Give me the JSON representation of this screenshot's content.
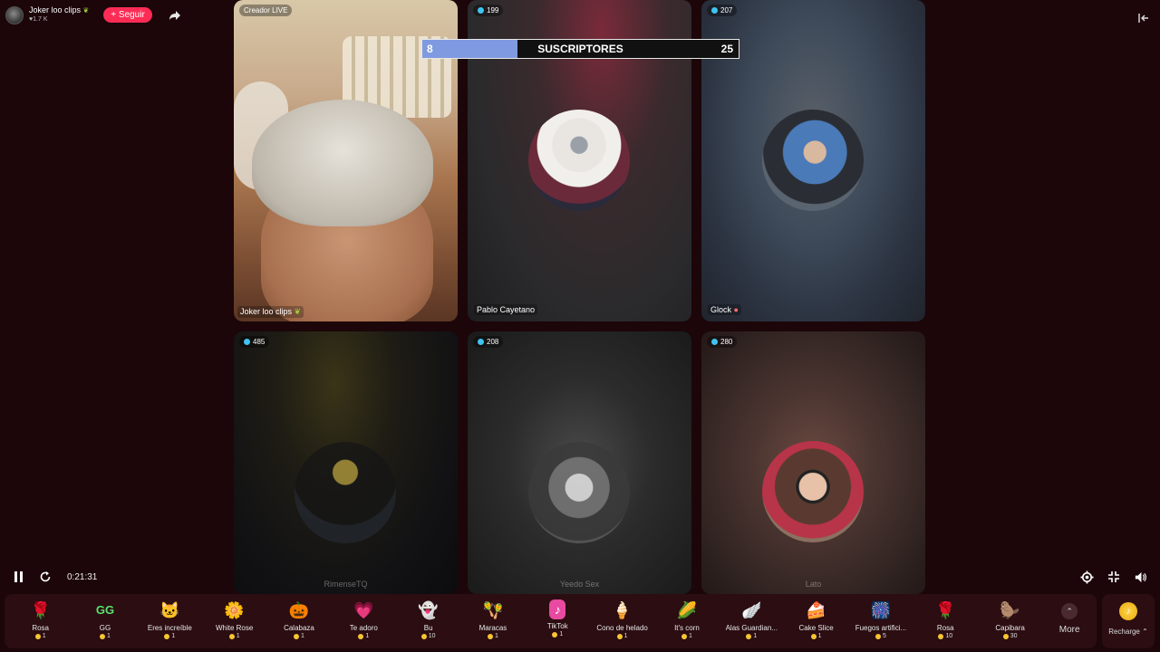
{
  "host": {
    "name": "Joker loo clips",
    "likes": "1.7 K",
    "follow_label": "+ Seguir"
  },
  "subscribers_bar": {
    "title": "SUSCRIPTORES",
    "left_value": "8",
    "right_value": "25",
    "fill_fraction": 0.3,
    "accent_color": "#7f9ae0"
  },
  "tiles": [
    {
      "badge": "Creador LIVE",
      "name": "Joker loo clips",
      "bottom": ""
    },
    {
      "badge": "199",
      "name": "Pablo Cayetano",
      "bottom": ""
    },
    {
      "badge": "207",
      "name": "Glock",
      "bottom": ""
    },
    {
      "badge": "485",
      "name": "",
      "bottom": "RimenseTQ"
    },
    {
      "badge": "208",
      "name": "",
      "bottom": "Yeedo Sex"
    },
    {
      "badge": "280",
      "name": "",
      "bottom": "Lato"
    }
  ],
  "player": {
    "time": "0:21:31"
  },
  "gifts": [
    {
      "name": "Rosa",
      "price": "1",
      "icon": "rose-icon",
      "glyph": "🌹"
    },
    {
      "name": "GG",
      "price": "1",
      "icon": "gg-icon",
      "glyph": "GG"
    },
    {
      "name": "Eres increíble",
      "price": "1",
      "icon": "cat-icon",
      "glyph": "🐱"
    },
    {
      "name": "White Rose",
      "price": "1",
      "icon": "white-rose-icon",
      "glyph": "🌼"
    },
    {
      "name": "Calabaza",
      "price": "1",
      "icon": "pumpkin-icon",
      "glyph": "🎃"
    },
    {
      "name": "Te adoro",
      "price": "1",
      "icon": "heart-icon",
      "glyph": "💗"
    },
    {
      "name": "Bu",
      "price": "10",
      "icon": "ghost-icon",
      "glyph": "👻"
    },
    {
      "name": "Maracas",
      "price": "1",
      "icon": "maracas-icon",
      "glyph": "🪇"
    },
    {
      "name": "TikTok",
      "price": "1",
      "icon": "tiktok-icon",
      "glyph": "♪"
    },
    {
      "name": "Cono de helado",
      "price": "1",
      "icon": "ice-cream-icon",
      "glyph": "🍦"
    },
    {
      "name": "It's corn",
      "price": "1",
      "icon": "corn-icon",
      "glyph": "🌽"
    },
    {
      "name": "Alas Guardian...",
      "price": "1",
      "icon": "wings-icon",
      "glyph": "🪽"
    },
    {
      "name": "Cake Slice",
      "price": "1",
      "icon": "cake-icon",
      "glyph": "🍰"
    },
    {
      "name": "Fuegos artifici...",
      "price": "5",
      "icon": "fireworks-icon",
      "glyph": "🎆"
    },
    {
      "name": "Rosa",
      "price": "10",
      "icon": "rose-icon",
      "glyph": "🌹"
    },
    {
      "name": "Capibara",
      "price": "30",
      "icon": "capybara-icon",
      "glyph": "🦫"
    }
  ],
  "more_label": "More",
  "recharge_label": "Recharge ⌃"
}
